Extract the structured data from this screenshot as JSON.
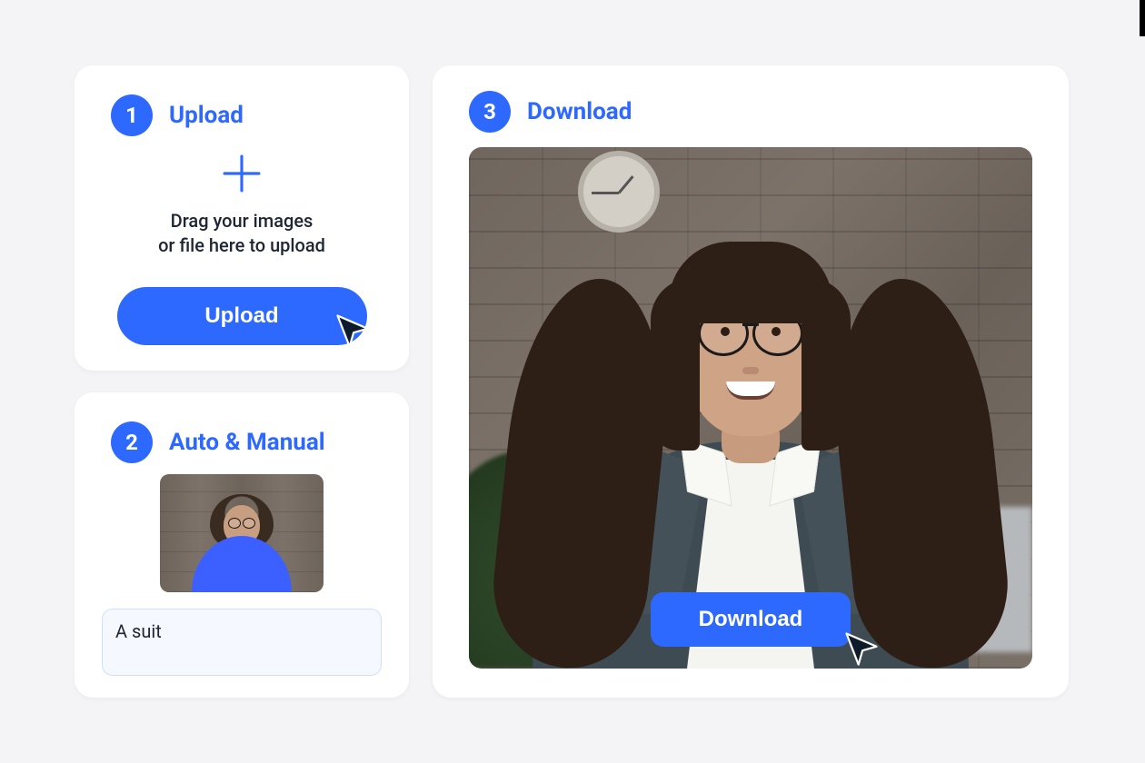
{
  "colors": {
    "accent": "#2e69ff"
  },
  "steps": {
    "upload": {
      "number": "1",
      "title": "Upload",
      "drag_line1": "Drag your images",
      "drag_line2": "or file here to upload",
      "button_label": "Upload"
    },
    "edit": {
      "number": "2",
      "title": "Auto & Manual",
      "input_value": "A suit"
    },
    "download": {
      "number": "3",
      "title": "Download",
      "button_label": "Download"
    }
  }
}
